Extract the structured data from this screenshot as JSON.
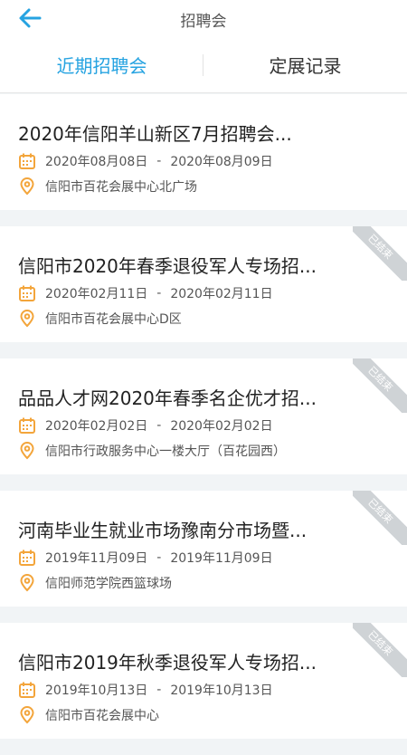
{
  "header": {
    "title": "招聘会",
    "back_icon": "arrow-left-icon"
  },
  "tabs": [
    {
      "label": "近期招聘会",
      "active": true
    },
    {
      "label": "定展记录",
      "active": false
    }
  ],
  "colors": {
    "accent": "#26a3e1",
    "icon": "#f3a53b",
    "ribbon": "#cfd3d6"
  },
  "fairs": [
    {
      "title": "2020年信阳羊山新区7月招聘会...",
      "start": "2020年08月08日",
      "end": "2020年08月09日",
      "location": "信阳市百花会展中心北广场",
      "badge": ""
    },
    {
      "title": "信阳市2020年春季退役军人专场招...",
      "start": "2020年02月11日",
      "end": "2020年02月11日",
      "location": "信阳市百花会展中心D区",
      "badge": "已结束"
    },
    {
      "title": "品品人才网2020年春季名企优才招...",
      "start": "2020年02月02日",
      "end": "2020年02月02日",
      "location": "信阳市行政服务中心一楼大厅（百花园西）",
      "badge": "已结束"
    },
    {
      "title": "河南毕业生就业市场豫南分市场暨...",
      "start": "2019年11月09日",
      "end": "2019年11月09日",
      "location": "信阳师范学院西篮球场",
      "badge": "已结束"
    },
    {
      "title": "信阳市2019年秋季退役军人专场招...",
      "start": "2019年10月13日",
      "end": "2019年10月13日",
      "location": "信阳市百花会展中心",
      "badge": "已结束"
    }
  ],
  "date_separator": "-"
}
